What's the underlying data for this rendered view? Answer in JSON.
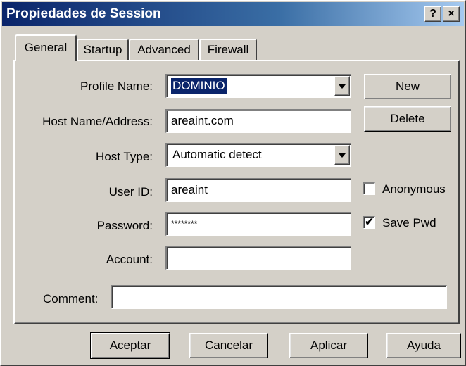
{
  "window": {
    "title": "Propiedades de Session",
    "help_label": "?",
    "close_label": "×"
  },
  "tabs": [
    {
      "label": "General",
      "active": true
    },
    {
      "label": "Startup",
      "active": false
    },
    {
      "label": "Advanced",
      "active": false
    },
    {
      "label": "Firewall",
      "active": false
    }
  ],
  "form": {
    "profile_name": {
      "label": "Profile Name:",
      "value": "DOMINIO"
    },
    "host_address": {
      "label": "Host Name/Address:",
      "value": "areaint.com"
    },
    "host_type": {
      "label": "Host Type:",
      "value": "Automatic detect"
    },
    "user_id": {
      "label": "User ID:",
      "value": "areaint"
    },
    "password": {
      "label": "Password:",
      "value": "********"
    },
    "account": {
      "label": "Account:",
      "value": ""
    },
    "comment": {
      "label": "Comment:",
      "value": ""
    }
  },
  "side_buttons": {
    "new_label": "New",
    "delete_label": "Delete"
  },
  "checkboxes": {
    "anonymous": {
      "label": "Anonymous",
      "checked": false,
      "mark": ""
    },
    "save_pwd": {
      "label": "Save Pwd",
      "checked": true,
      "mark": "✔"
    }
  },
  "footer": {
    "ok_label": "Aceptar",
    "cancel_label": "Cancelar",
    "apply_label": "Aplicar",
    "help_label": "Ayuda"
  },
  "colors": {
    "titlebar_start": "#0a246a",
    "titlebar_end": "#a6caf0",
    "face": "#d4d0c8",
    "selection": "#0a246a"
  }
}
